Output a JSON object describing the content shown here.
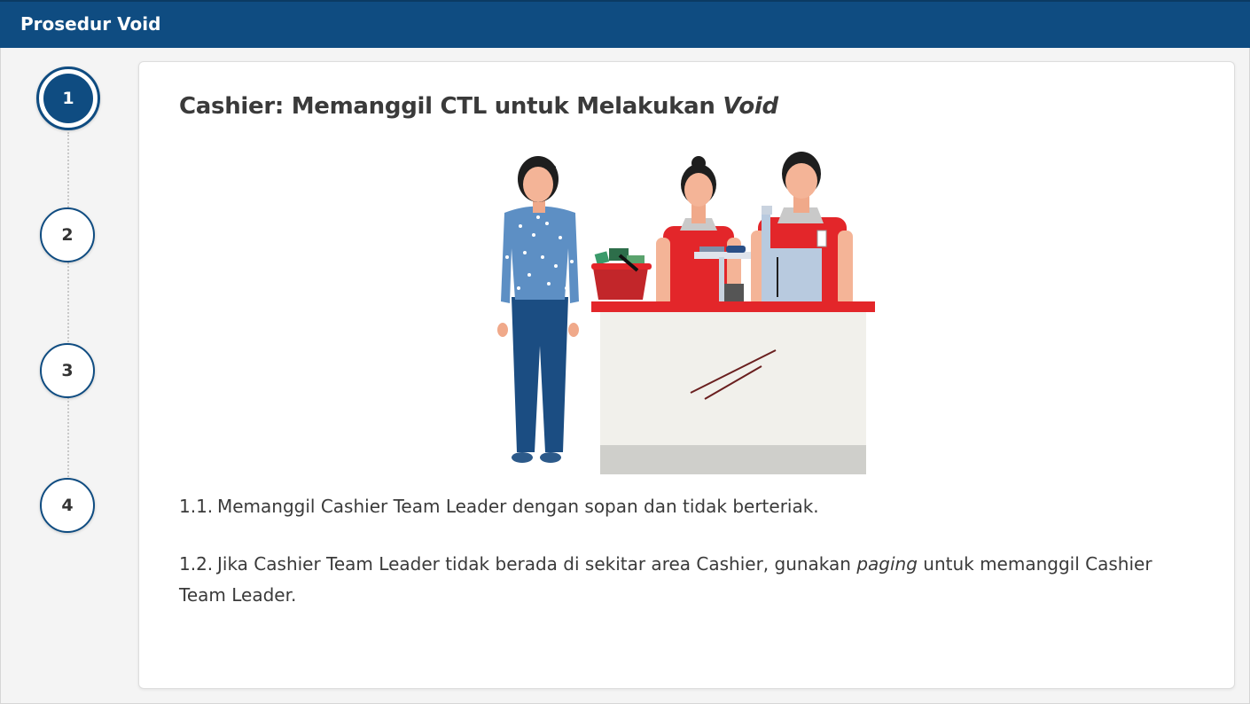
{
  "header": {
    "title": "Prosedur Void"
  },
  "steps": [
    {
      "label": "1",
      "active": true
    },
    {
      "label": "2",
      "active": false
    },
    {
      "label": "3",
      "active": false
    },
    {
      "label": "4",
      "active": false
    }
  ],
  "content": {
    "title_main": "Cashier: Memanggil CTL untuk Melakukan ",
    "title_emph": "Void",
    "items": [
      {
        "number": "1.1.",
        "text": "Memanggil Cashier Team Leader dengan sopan dan tidak berteriak."
      },
      {
        "number": "1.2.",
        "text_before": "Jika Cashier Team Leader tidak berada di sekitar area Cashier, gunakan ",
        "text_emph": "paging",
        "text_after": " untuk memanggil Cashier Team Leader."
      }
    ]
  },
  "colors": {
    "header_bg": "#0f4c81",
    "accent_red": "#e3262a",
    "text": "#3a3a3a"
  }
}
